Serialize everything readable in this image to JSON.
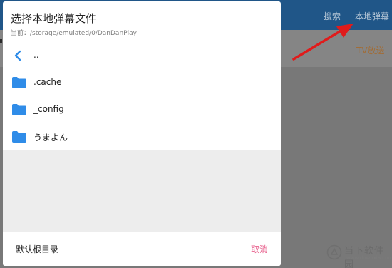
{
  "background_app": {
    "nav_items": [
      "搜索",
      "本地弹幕"
    ],
    "tv_label": "TV放送"
  },
  "dialog": {
    "title": "选择本地弹幕文件",
    "current_path": "当前：/storage/emulated/0/DanDanPlay",
    "items": [
      {
        "label": "..",
        "icon": "back-chevron-icon"
      },
      {
        "label": ".cache",
        "icon": "folder-icon"
      },
      {
        "label": "_config",
        "icon": "folder-icon"
      },
      {
        "label": "うまよん",
        "icon": "folder-icon"
      }
    ],
    "default_root_label": "默认根目录",
    "cancel_label": "取消"
  },
  "watermark": {
    "text": "当下软件园",
    "url": "www.downxia.com"
  },
  "colors": {
    "topbar": "#205688",
    "folder": "#2f8ce8",
    "cancel": "#e8618d",
    "arrow": "#e01b1b"
  }
}
